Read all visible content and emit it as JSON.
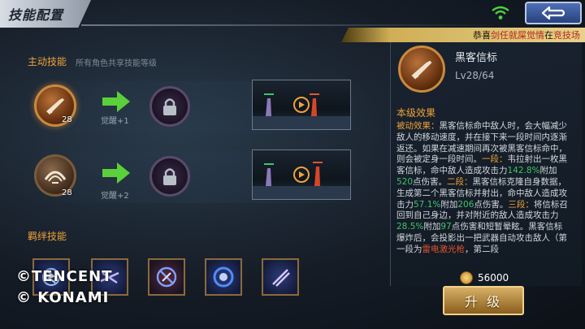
{
  "header": {
    "title": "技能配置",
    "ticker": {
      "prefix": "恭喜",
      "player": "剑任就屎觉情",
      "middle": "在",
      "location": "竞技场"
    }
  },
  "active_skills": {
    "title": "主动技能",
    "subtitle": "所有角色共享技能等级",
    "rows": [
      {
        "level": "28",
        "awaken": "觉醒+1"
      },
      {
        "level": "28",
        "awaken": "觉醒+2"
      }
    ]
  },
  "bond_skills": {
    "title": "羁绊技能",
    "count": 5
  },
  "watermark": {
    "line1": "©TENCENT",
    "line2": "© KONAMI"
  },
  "detail": {
    "name": "黑客信标",
    "level": "Lv28/64",
    "section": "本级效果",
    "desc": [
      {
        "t": "被动效果：",
        "c": "o"
      },
      {
        "t": "黑客信标命中敌人时，会大幅减少敌人的移动速度，并在接下来一段时间内逐渐返还。如果在减速期间再次被黑客信标命中，则会被定身一段时间。",
        "c": ""
      },
      {
        "t": "一段：",
        "c": "o"
      },
      {
        "t": "韦拉射出一枚黑客信标，命中敌人造成攻击力",
        "c": ""
      },
      {
        "t": "142.8%",
        "c": "g"
      },
      {
        "t": "附加",
        "c": ""
      },
      {
        "t": "520",
        "c": "g"
      },
      {
        "t": "点伤害。",
        "c": ""
      },
      {
        "t": "二段：",
        "c": "o"
      },
      {
        "t": "黑客信标克隆自身数据，生成第二个黑客信标并射出，命中敌人造成攻击力",
        "c": ""
      },
      {
        "t": "57.1%",
        "c": "g"
      },
      {
        "t": "附加",
        "c": ""
      },
      {
        "t": "206",
        "c": "g"
      },
      {
        "t": "点伤害。",
        "c": ""
      },
      {
        "t": "三段：",
        "c": "o"
      },
      {
        "t": "将信标召回到自己身边，并对附近的敌人造成攻击力",
        "c": ""
      },
      {
        "t": "28.5%",
        "c": "g"
      },
      {
        "t": "附加",
        "c": ""
      },
      {
        "t": "97",
        "c": "g"
      },
      {
        "t": "点伤害和短暂晕眩。",
        "c": ""
      },
      {
        "t": "黑客信标爆炸后，会投影出一把武器自动攻击敌人（第一段为",
        "c": ""
      },
      {
        "t": "雷电激光枪",
        "c": "r"
      },
      {
        "t": "，第二段",
        "c": ""
      }
    ]
  },
  "cost": "56000",
  "upgrade_label": "升 级",
  "colors": {
    "accent": "#f0a23a",
    "highlight_green": "#3fc46a",
    "arrow_green": "#5ad03a"
  },
  "icons": {
    "back": "back-arrow-icon",
    "wifi": "wifi-signal-icon",
    "lock": "padlock-icon",
    "play": "play-icon",
    "coin": "gold-coin-icon"
  }
}
